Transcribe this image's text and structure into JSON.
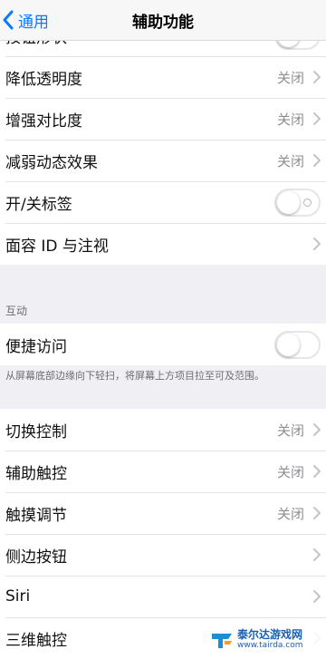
{
  "nav": {
    "back_label": "通用",
    "title": "辅助功能"
  },
  "group1": {
    "rows": [
      {
        "label": "按钮形状",
        "type": "toggle",
        "on": false
      },
      {
        "label": "降低透明度",
        "type": "value",
        "value": "关闭"
      },
      {
        "label": "增强对比度",
        "type": "value",
        "value": "关闭"
      },
      {
        "label": "减弱动态效果",
        "type": "value",
        "value": "关闭"
      },
      {
        "label": "开/关标签",
        "type": "toggle",
        "on": false
      },
      {
        "label": "面容 ID 与注视",
        "type": "chevron"
      }
    ]
  },
  "interaction": {
    "header": "互动",
    "rows": [
      {
        "label": "便捷访问",
        "type": "toggle",
        "on": false
      }
    ],
    "footer": "从屏幕底部边缘向下轻扫，将屏幕上方项目拉至可及范围。"
  },
  "group3": {
    "rows": [
      {
        "label": "切换控制",
        "type": "value",
        "value": "关闭"
      },
      {
        "label": "辅助触控",
        "type": "value",
        "value": "关闭"
      },
      {
        "label": "触摸调节",
        "type": "value",
        "value": "关闭"
      },
      {
        "label": "侧边按钮",
        "type": "chevron"
      },
      {
        "label": "Siri",
        "type": "chevron"
      },
      {
        "label": "三维触控",
        "type": "chevron"
      }
    ]
  },
  "watermark": {
    "name": "泰尔达游戏网",
    "url": "www.tairda.com"
  },
  "colors": {
    "accent": "#0a7aff",
    "background": "#efeff4",
    "secondary_text": "#8e8e93"
  }
}
